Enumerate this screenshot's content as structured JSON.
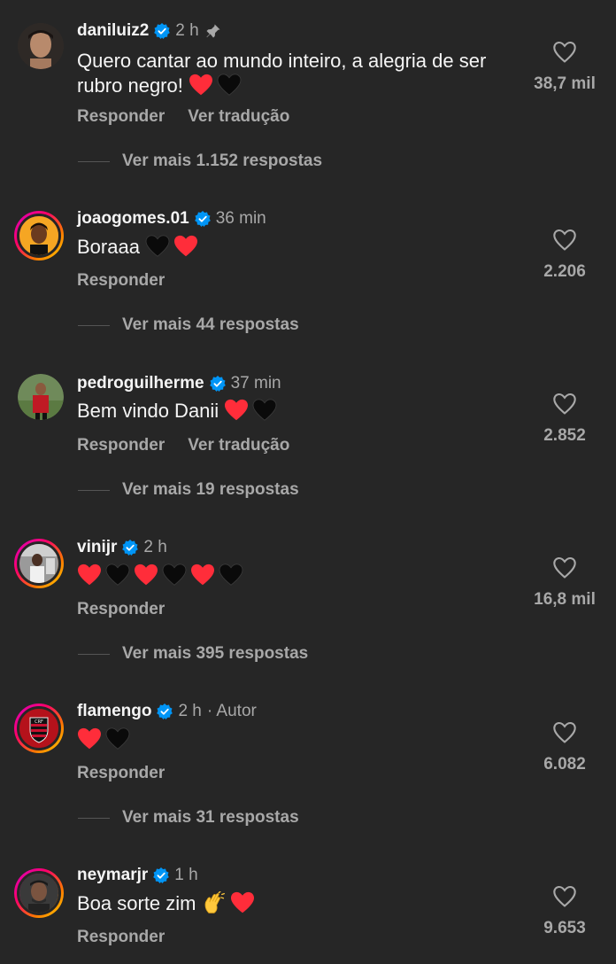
{
  "comments": [
    {
      "username": "daniluiz2",
      "time": "2 h",
      "author_tag": "",
      "text": "Quero cantar ao mundo inteiro, a alegria de ser rubro negro!",
      "emoji": [
        "red-heart",
        "black-heart"
      ],
      "reply_label": "Responder",
      "translate_label": "Ver tradução",
      "view_replies": "Ver mais 1.152 respostas",
      "likes": "38,7 mil",
      "pinned": true
    },
    {
      "username": "joaogomes.01",
      "time": "36 min",
      "text": "Boraaa",
      "emoji": [
        "black-heart",
        "red-heart"
      ],
      "reply_label": "Responder",
      "view_replies": "Ver mais 44 respostas",
      "likes": "2.206"
    },
    {
      "username": "pedroguilherme",
      "time": "37 min",
      "text": "Bem vindo Danii",
      "emoji": [
        "red-heart",
        "black-heart"
      ],
      "reply_label": "Responder",
      "translate_label": "Ver tradução",
      "view_replies": "Ver mais 19 respostas",
      "likes": "2.852"
    },
    {
      "username": "vinijr",
      "time": "2 h",
      "text": "",
      "emoji": [
        "red-heart",
        "black-heart",
        "red-heart",
        "black-heart",
        "red-heart",
        "black-heart"
      ],
      "reply_label": "Responder",
      "view_replies": "Ver mais 395 respostas",
      "likes": "16,8 mil"
    },
    {
      "username": "flamengo",
      "time": "2 h",
      "author_tag": "· Autor",
      "text": "",
      "emoji": [
        "red-heart",
        "black-heart"
      ],
      "reply_label": "Responder",
      "view_replies": "Ver mais 31 respostas",
      "likes": "6.082"
    },
    {
      "username": "neymarjr",
      "time": "1 h",
      "text": "Boa sorte zim",
      "emoji": [
        "clapping-hands",
        "red-heart"
      ],
      "reply_label": "Responder",
      "likes": "9.653"
    }
  ],
  "colors": {
    "background": "#262626",
    "primary_text": "#f5f5f5",
    "secondary_text": "#a8a8a8",
    "verified": "#0095f6",
    "red_heart": "#ff2d3a",
    "flamengo_red": "#c8102e"
  }
}
